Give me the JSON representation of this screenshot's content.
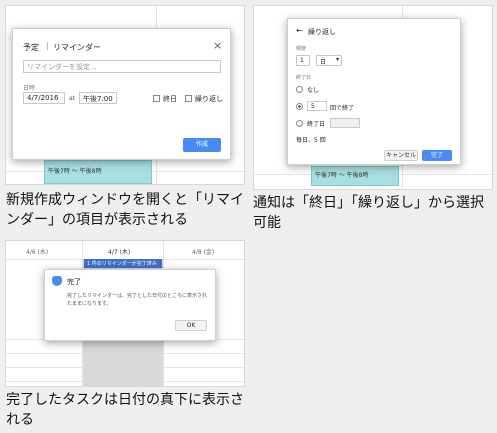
{
  "panel1": {
    "tab_label": "予定",
    "tab_active": "リマインダー",
    "close": "×",
    "input_placeholder": "リマインダーを設定...",
    "date_label": "日時",
    "date_value": "4/7/2016",
    "at_label": "at",
    "time_value": "午後7:00",
    "allday_label": "終日",
    "repeat_label": "繰り返し",
    "create_button": "作成",
    "event_label": "午後7時 〜 午後8時",
    "caption": "新規作成ウィンドウを開くと「リマインダー」の項目が表示される"
  },
  "panel2": {
    "back": "←",
    "title": "繰り返し",
    "freq_label": "頻度",
    "freq_value": "1",
    "freq_unit": "日",
    "end_label": "終了日",
    "opt_none": "なし",
    "opt_count_value": "5",
    "opt_count_suffix": "回で終了",
    "opt_date": "終了日",
    "summary": "毎日、5 回",
    "cancel_button": "キャンセル",
    "done_button": "完了",
    "event_label": "午後7時 〜 午後8時",
    "caption": "通知は「終日」「繰り返し」から選択可能"
  },
  "panel3": {
    "col1": "4/6 (水)",
    "col2": "4/7 (木)",
    "col3": "4/8 (金)",
    "task_chip": "1 件のリマインダーが完了済み",
    "dialog_title": "完了",
    "dialog_body": "完了したリマインダーは、完了とした日付のところに表示されたままになります。",
    "ok_button": "OK",
    "caption": "完了したタスクは日付の真下に表示される"
  },
  "colors": {
    "accent": "#4a8af4",
    "teal": "#a8dfe0",
    "task": "#3f6fc9"
  }
}
